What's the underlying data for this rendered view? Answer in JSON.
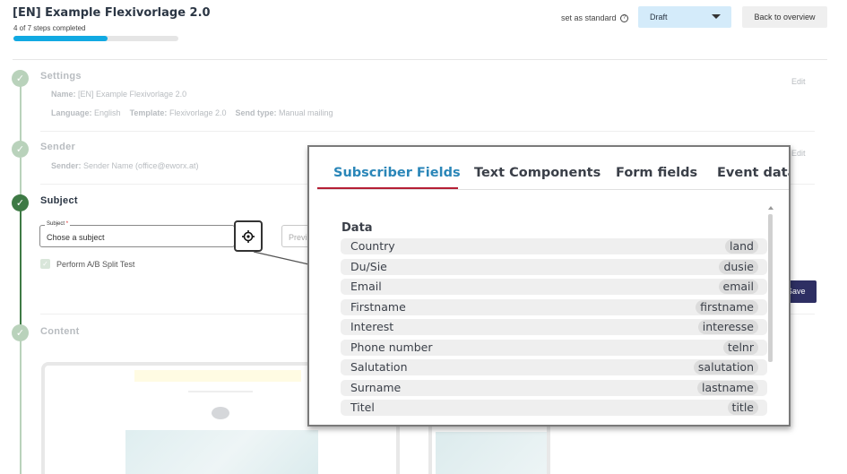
{
  "header": {
    "title": "[EN] Example Flexivorlage 2.0",
    "steps_completed": "4 of 7 steps completed",
    "progress_fraction": 0.57,
    "set_standard": "set as standard",
    "help_icon": "question-circle-icon",
    "status_select": "Draft",
    "back_button": "Back to overview"
  },
  "steps": {
    "settings": {
      "title": "Settings",
      "name_label": "Name:",
      "name_value": "[EN] Example Flexivorlage 2.0",
      "language_label": "Language:",
      "language_value": "English",
      "template_label": "Template:",
      "template_value": "Flexivorlage 2.0",
      "send_type_label": "Send type:",
      "send_type_value": "Manual mailing",
      "edit": "Edit"
    },
    "sender": {
      "title": "Sender",
      "sender_label": "Sender:",
      "sender_value": "Sender Name (office@eworx.at)",
      "edit": "Edit"
    },
    "subject": {
      "title": "Subject",
      "field_label": "Subject",
      "required_mark": "*",
      "field_value": "Chose a subject",
      "preview_placeholder": "Previ",
      "ab_test_label": "Perform A/B Split Test",
      "save_button": "Save"
    },
    "content": {
      "title": "Content"
    }
  },
  "popup": {
    "tabs": [
      {
        "label": "Subscriber Fields",
        "active": true
      },
      {
        "label": "Text Components",
        "active": false
      },
      {
        "label": "Form fields",
        "active": false
      },
      {
        "label": "Event data",
        "active": false
      }
    ],
    "section_heading": "Data",
    "fields": [
      {
        "name": "Country",
        "key": "land"
      },
      {
        "name": "Du/Sie",
        "key": "dusie"
      },
      {
        "name": "Email",
        "key": "email"
      },
      {
        "name": "Firstname",
        "key": "firstname"
      },
      {
        "name": "Interest",
        "key": "interesse"
      },
      {
        "name": "Phone number",
        "key": "telnr"
      },
      {
        "name": "Salutation",
        "key": "salutation"
      },
      {
        "name": "Surname",
        "key": "lastname"
      },
      {
        "name": "Titel",
        "key": "title"
      }
    ]
  },
  "colors": {
    "accent_blue": "#11a9e2",
    "active_tab": "#2a86b8",
    "tab_underline": "#b51f35",
    "step_done": "#b9d2bb",
    "step_active": "#3e7a45",
    "save_button": "#2e2f63"
  }
}
